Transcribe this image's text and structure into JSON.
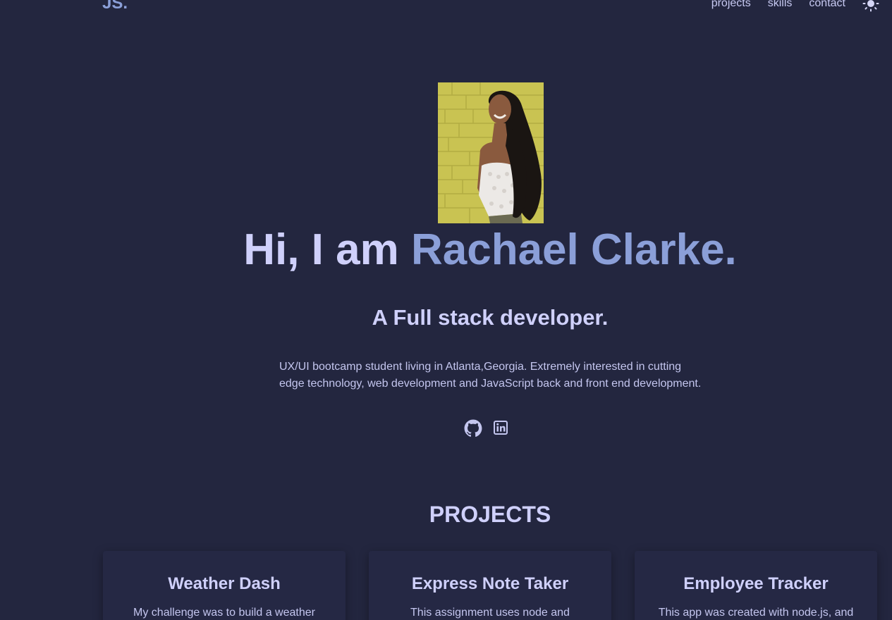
{
  "header": {
    "logo": "JS.",
    "nav": [
      {
        "label": "projects"
      },
      {
        "label": "skills"
      },
      {
        "label": "contact"
      }
    ],
    "theme_icon": "sun-icon"
  },
  "hero": {
    "greeting": "Hi, I am ",
    "name": "Rachael Clarke.",
    "role": "A Full stack developer.",
    "about": "UX/UI bootcamp student living in Atlanta,Georgia. Extremely interested in cutting edge technology, web development and JavaScript back and front end development.",
    "social_icons": [
      "github-icon",
      "linkedin-icon"
    ]
  },
  "projects": {
    "heading": "PROJECTS",
    "items": [
      {
        "title": "Weather Dash",
        "description": "My challenge was to build a weather"
      },
      {
        "title": "Express Note Taker",
        "description": "This assignment uses node and"
      },
      {
        "title": "Employee Tracker",
        "description": "This app was created with node.js, and"
      }
    ]
  },
  "colors": {
    "background": "#23263f",
    "accent": "#8b9fd8",
    "text": "#cfd0fb"
  }
}
